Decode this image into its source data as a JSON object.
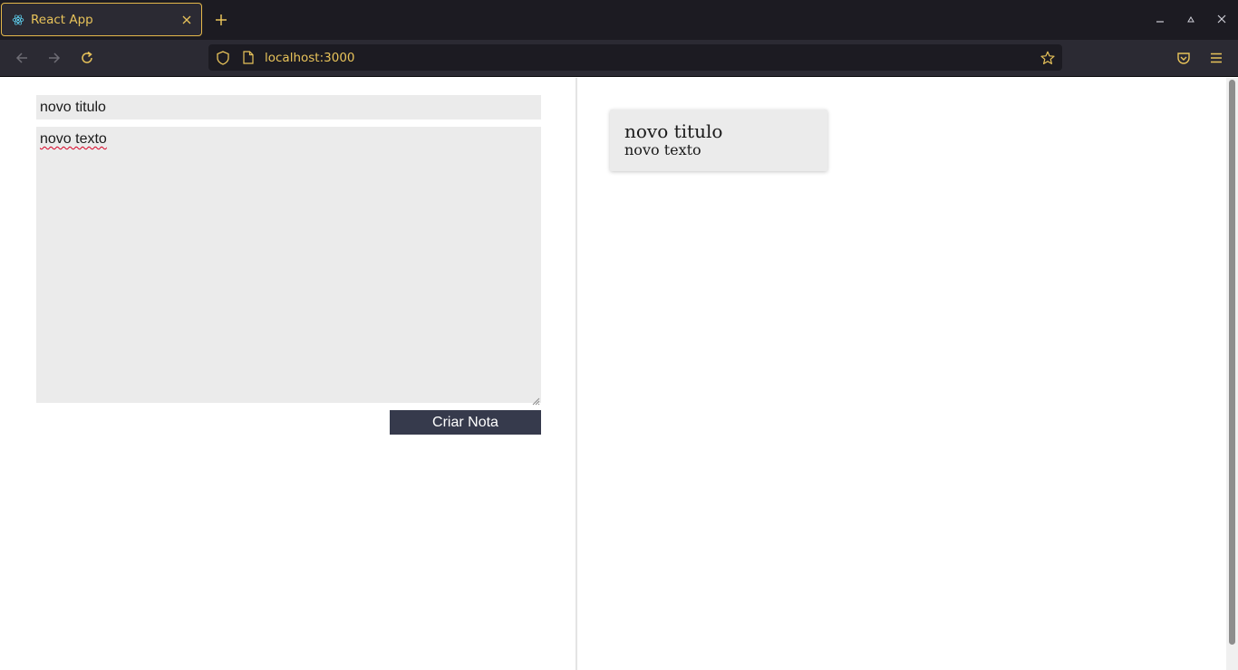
{
  "browser": {
    "tab": {
      "title": "React App",
      "favicon": "react-icon",
      "close_icon": "close-icon"
    },
    "new_tab_icon": "plus-icon",
    "window_controls": [
      "minimize-icon",
      "maximize-icon",
      "close-icon"
    ],
    "nav": {
      "back_icon": "arrow-left-icon",
      "forward_icon": "arrow-right-icon",
      "reload_icon": "reload-icon",
      "url": "localhost:3000",
      "bookmark_icon": "star-icon",
      "pocket_icon": "pocket-icon",
      "menu_icon": "hamburger-menu-icon"
    },
    "accent_color": "#e8c35a"
  },
  "form": {
    "title_value": "novo titulo",
    "text_value": "novo texto",
    "submit_label": "Criar Nota",
    "button_color": "#363a4c",
    "field_color": "#ebebeb"
  },
  "notes": [
    {
      "title": "novo titulo",
      "text": "novo texto"
    }
  ]
}
